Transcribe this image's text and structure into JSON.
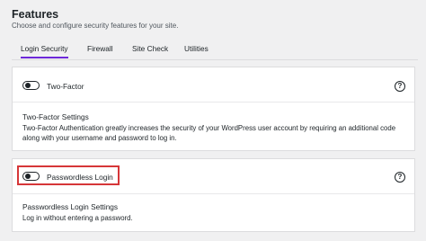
{
  "header": {
    "title": "Features",
    "subtitle": "Choose and configure security features for your site."
  },
  "tabs": [
    {
      "label": "Login Security",
      "active": true
    },
    {
      "label": "Firewall",
      "active": false
    },
    {
      "label": "Site Check",
      "active": false
    },
    {
      "label": "Utilities",
      "active": false
    }
  ],
  "features": [
    {
      "toggle_label": "Two-Factor",
      "enabled": false,
      "help_icon": "question-circle",
      "help_symbol": "?",
      "settings_title": "Two-Factor Settings",
      "settings_description": "Two-Factor Authentication greatly increases the security of your WordPress user account by requiring an additional code along with your username and password to log in."
    },
    {
      "toggle_label": "Passwordless Login",
      "enabled": false,
      "highlighted": true,
      "help_icon": "question-circle",
      "help_symbol": "?",
      "settings_title": "Passwordless Login Settings",
      "settings_description": "Log in without entering a password."
    }
  ],
  "colors": {
    "accent": "#6d28d9",
    "highlight": "#d63638"
  }
}
